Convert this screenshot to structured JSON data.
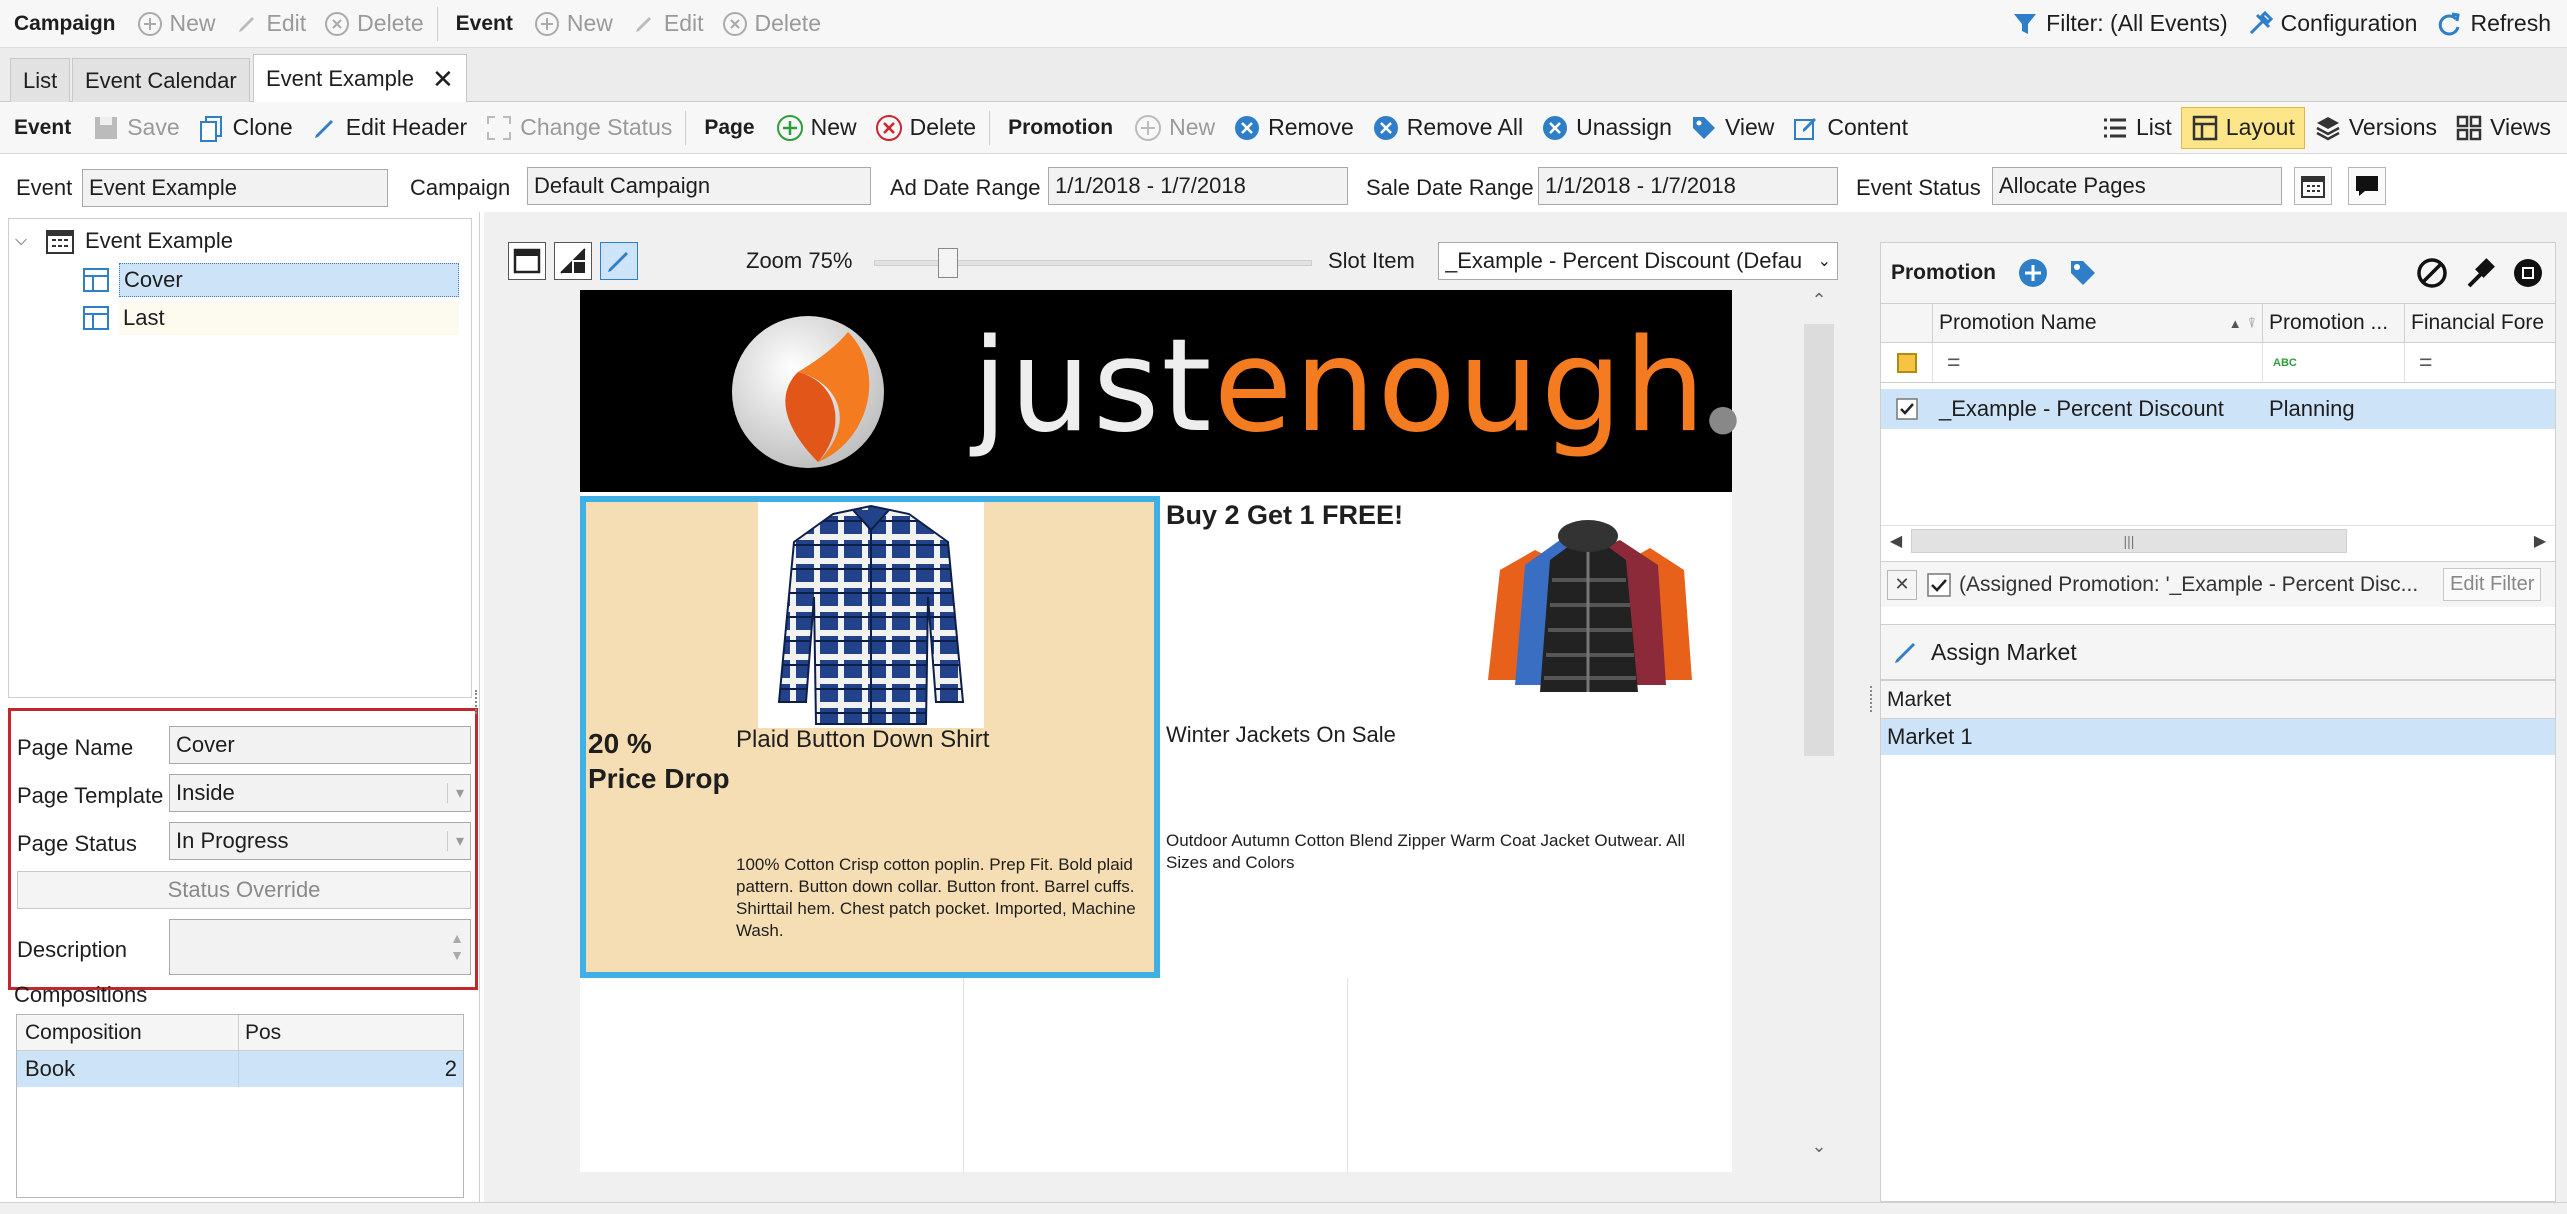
{
  "toolbar1": {
    "campaign_group": "Campaign",
    "campaign_new": "New",
    "campaign_edit": "Edit",
    "campaign_delete": "Delete",
    "event_group": "Event",
    "event_new": "New",
    "event_edit": "Edit",
    "event_delete": "Delete",
    "filter": "Filter: (All Events)",
    "configuration": "Configuration",
    "refresh": "Refresh"
  },
  "tabs": [
    {
      "label": "List"
    },
    {
      "label": "Event Calendar"
    },
    {
      "label": "Event Example"
    }
  ],
  "toolbar2": {
    "event_group": "Event",
    "save": "Save",
    "clone": "Clone",
    "edit_header": "Edit Header",
    "change_status": "Change Status",
    "page_group": "Page",
    "page_new": "New",
    "page_delete": "Delete",
    "promotion_group": "Promotion",
    "promo_new": "New",
    "remove": "Remove",
    "remove_all": "Remove All",
    "unassign": "Unassign",
    "view": "View",
    "content": "Content",
    "list": "List",
    "layout": "Layout",
    "versions": "Versions",
    "views": "Views"
  },
  "header": {
    "event_label": "Event",
    "event_value": "Event Example",
    "campaign_label": "Campaign",
    "campaign_value": "Default Campaign",
    "ad_date_label": "Ad Date Range",
    "ad_date_value": "1/1/2018 - 1/7/2018",
    "sale_date_label": "Sale Date Range",
    "sale_date_value": "1/1/2018 - 1/7/2018",
    "status_label": "Event Status",
    "status_value": "Allocate Pages"
  },
  "tree": {
    "root": "Event Example",
    "children": [
      "Cover",
      "Last"
    ]
  },
  "page_props": {
    "page_name_label": "Page Name",
    "page_name": "Cover",
    "page_template_label": "Page Template",
    "page_template": "Inside",
    "page_status_label": "Page Status",
    "page_status": "In Progress",
    "status_override": "Status Override",
    "description_label": "Description",
    "description": ""
  },
  "compositions": {
    "title": "Compositions",
    "col_composition": "Composition",
    "col_pos": "Pos",
    "rows": [
      {
        "composition": "Book",
        "pos": "2"
      }
    ]
  },
  "layout_toolbar": {
    "zoom_label": "Zoom 75%",
    "zoom_percent": 75,
    "slot_item_label": "Slot Item",
    "slot_item_value": "_Example - Percent Discount (Defau"
  },
  "canvas": {
    "logo_left": "just",
    "logo_right": "enough",
    "promo1_discount_line1": "20 %",
    "promo1_discount_line2": "Price Drop",
    "promo1_title": "Plaid Button Down Shirt",
    "promo1_desc": "100% Cotton Crisp cotton poplin. Prep Fit. Bold plaid pattern. Button down collar. Button front. Barrel cuffs. Shirttail hem. Chest patch pocket. Imported, Machine Wash.",
    "promo2_headline": "Buy 2 Get 1 FREE!",
    "promo2_title": "Winter Jackets On Sale",
    "promo2_desc": "Outdoor Autumn Cotton Blend Zipper Warm Coat Jacket Outwear. All Sizes and Colors"
  },
  "promotion_panel": {
    "title": "Promotion",
    "col_name": "Promotion Name",
    "col_status": "Promotion ...",
    "col_forecast": "Financial Fore",
    "filter_eq": "=",
    "filter_abc": "ABC",
    "rows": [
      {
        "name": "_Example - Percent Discount",
        "status": "Planning",
        "checked": true
      }
    ],
    "filter_text": "(Assigned Promotion: '_Example - Percent Disc...",
    "edit_filter": "Edit Filter"
  },
  "market_panel": {
    "title": "Assign Market",
    "col_market": "Market",
    "rows": [
      "Market 1"
    ]
  },
  "colors": {
    "accent_selected": "#cde3f7",
    "layout_active": "#fde68a",
    "highlight_border": "#c1272d",
    "slot_border": "#3fb0e6",
    "promo_bg": "#f5deb3",
    "logo_orange": "#f47b20"
  }
}
